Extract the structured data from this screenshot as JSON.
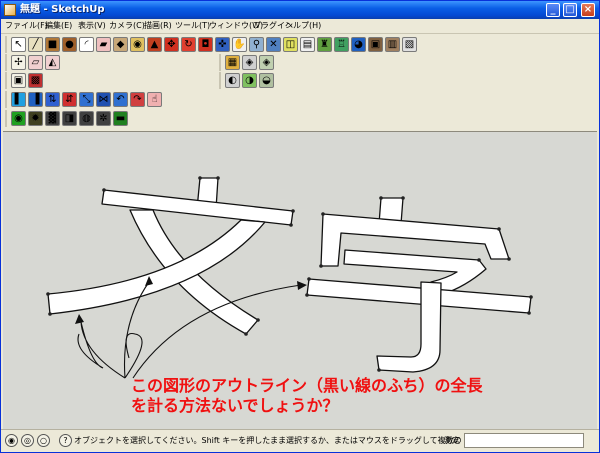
{
  "window": {
    "title": "無題 - SketchUp",
    "minimize_glyph": "_",
    "maximize_glyph": "□",
    "close_glyph": "×"
  },
  "menu": [
    "ファイル(F)",
    "編集(E)",
    "表示(V)",
    "カメラ(C)",
    "描画(R)",
    "ツール(T)",
    "ウィンドウ(W)",
    "プラグイン",
    "ヘルプ(H)"
  ],
  "toolbars": {
    "row1": [
      {
        "icon": "select-arrow-icon",
        "glyph": "↖",
        "color": "#ffffff"
      },
      {
        "icon": "pencil-line-icon",
        "glyph": "╱",
        "color": "#e8e0c0"
      },
      {
        "icon": "rectangle-icon",
        "glyph": "■",
        "color": "#b07838"
      },
      {
        "icon": "circle-icon",
        "glyph": "●",
        "color": "#a0602a"
      },
      {
        "icon": "arc-icon",
        "glyph": "◜",
        "color": "#ffffff"
      },
      {
        "icon": "eraser-icon",
        "glyph": "▰",
        "color": "#f0c0c0"
      },
      {
        "icon": "paint-bucket-icon",
        "glyph": "◆",
        "color": "#c8a878"
      },
      {
        "icon": "tape-measure-icon",
        "glyph": "◉",
        "color": "#e0c060"
      },
      {
        "icon": "push-pull-icon",
        "glyph": "▲",
        "color": "#c04020"
      },
      {
        "icon": "move-icon",
        "glyph": "✥",
        "color": "#d03020"
      },
      {
        "icon": "rotate-icon",
        "glyph": "↻",
        "color": "#e04030"
      },
      {
        "icon": "offset-icon",
        "glyph": "◘",
        "color": "#d03020"
      },
      {
        "icon": "orbit-icon",
        "glyph": "✜",
        "color": "#3060c0"
      },
      {
        "icon": "pan-hand-icon",
        "glyph": "✋",
        "color": "#f0f0f0"
      },
      {
        "icon": "zoom-icon",
        "glyph": "⚲",
        "color": "#90b0d0"
      },
      {
        "icon": "zoom-extents-icon",
        "glyph": "✕",
        "color": "#5080c0"
      },
      {
        "icon": "section-plane-icon",
        "glyph": "◫",
        "color": "#e0e060"
      },
      {
        "icon": "text-note-icon",
        "glyph": "▤",
        "color": "#f0f0f0"
      },
      {
        "icon": "get-models-icon",
        "glyph": "♜",
        "color": "#60a040"
      },
      {
        "icon": "share-model-icon",
        "glyph": "♖",
        "color": "#40a060"
      },
      {
        "icon": "google-earth-icon",
        "glyph": "◕",
        "color": "#2060c0"
      },
      {
        "icon": "photo-texture-icon",
        "glyph": "▣",
        "color": "#806040"
      },
      {
        "icon": "extension-warehouse-icon",
        "glyph": "▥",
        "color": "#a08060"
      },
      {
        "icon": "send-to-layout-icon",
        "glyph": "▧",
        "color": "#e0e0e0"
      }
    ],
    "row2_left": [
      {
        "icon": "axes-orient-icon",
        "glyph": "✢",
        "color": "#f4f2e6"
      },
      {
        "icon": "dimension-icon",
        "glyph": "▱",
        "color": "#f0d0d0"
      },
      {
        "icon": "protractor-icon",
        "glyph": "◭",
        "color": "#f0d0d0"
      }
    ],
    "row2_right": [
      {
        "icon": "iso-view-icon",
        "glyph": "▦",
        "color": "#e0b040"
      },
      {
        "icon": "wireframe-style-icon",
        "glyph": "◈",
        "color": "#d0d0d0"
      },
      {
        "icon": "shaded-style-icon",
        "glyph": "◈",
        "color": "#c0d0b0"
      }
    ],
    "row3_left": [
      {
        "icon": "component-icon",
        "glyph": "▣",
        "color": "#f4f2e6"
      },
      {
        "icon": "group-icon",
        "glyph": "▩",
        "color": "#c03030"
      }
    ],
    "row3_right": [
      {
        "icon": "hidden-line-icon",
        "glyph": "◐",
        "color": "#d0d0d0"
      },
      {
        "icon": "shaded-texture-icon",
        "glyph": "◑",
        "color": "#80c060"
      },
      {
        "icon": "monochrome-icon",
        "glyph": "◒",
        "color": "#b0c0a0"
      }
    ],
    "row4": [
      {
        "icon": "solid-tool-1-icon",
        "glyph": "▌",
        "color": "#20a0e0"
      },
      {
        "icon": "solid-tool-2-icon",
        "glyph": "▐",
        "color": "#2060c0"
      },
      {
        "icon": "flip-arrows-icon",
        "glyph": "⇅",
        "color": "#3060d0"
      },
      {
        "icon": "flip-red-icon",
        "glyph": "⇵",
        "color": "#d03030"
      },
      {
        "icon": "scale-icon",
        "glyph": "⤡",
        "color": "#3070d0"
      },
      {
        "icon": "intersect-icon",
        "glyph": "⋈",
        "color": "#2050b0"
      },
      {
        "icon": "follow-me-icon",
        "glyph": "↶",
        "color": "#3070d0"
      },
      {
        "icon": "curve-arrow-icon",
        "glyph": "↷",
        "color": "#d04040"
      },
      {
        "icon": "hand-grab-icon",
        "glyph": "☝",
        "color": "#f0b0b0"
      }
    ],
    "row5": [
      {
        "icon": "shadow-toggle-icon",
        "glyph": "◉",
        "color": "#20a020"
      },
      {
        "icon": "sun-icon",
        "glyph": "✹",
        "color": "#404020"
      },
      {
        "icon": "fog-icon",
        "glyph": "▓",
        "color": "#404040"
      },
      {
        "icon": "edge-style-icon",
        "glyph": "◨",
        "color": "#404040"
      },
      {
        "icon": "color-palette-icon",
        "glyph": "◍",
        "color": "#404040"
      },
      {
        "icon": "settings-gear-icon",
        "glyph": "✲",
        "color": "#404040"
      },
      {
        "icon": "landscape-icon",
        "glyph": "▬",
        "color": "#208020"
      }
    ]
  },
  "annotation": {
    "line1": "この図形のアウトライン（黒い線のふち）の全長",
    "line2": "を計る方法ないでしょうか？",
    "color": "#f01010"
  },
  "status": {
    "hint": "オブジェクトを選択してください。Shift キーを押したまま選択するか、またはマウスをドラッグして複数の",
    "measure_label": "測定",
    "measure_value": ""
  }
}
